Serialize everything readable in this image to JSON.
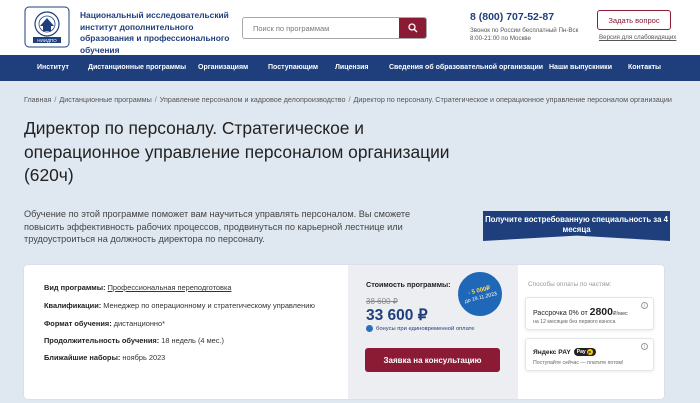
{
  "header": {
    "logo_name": "institute-seal",
    "logo_text": "Национальный исследовательский институт дополнительного образования и профессионального обучения",
    "search_placeholder": "Поиск по программам",
    "phone": "8 (800) 707-52-87",
    "phone_note": "Звонок по России бесплатный Пн-Вск 8:00-21:00 по Москве",
    "ask_button": "Задать вопрос",
    "impaired_link": "Версия для слабовидящих"
  },
  "nav": {
    "items": [
      {
        "label": "Институт"
      },
      {
        "label": "Дистанционные программы"
      },
      {
        "label": "Организациям"
      },
      {
        "label": "Поступающим"
      },
      {
        "label": "Лицензия"
      },
      {
        "label": "Сведения об образовательной организации"
      },
      {
        "label": "Наши выпускники"
      },
      {
        "label": "Контакты"
      }
    ]
  },
  "breadcrumb": {
    "items": [
      {
        "label": "Главная"
      },
      {
        "label": "Дистанционные программы"
      },
      {
        "label": "Управление персоналом и кадровое делопроизводство"
      },
      {
        "label": "Директор по персоналу. Стратегическое и операционное управление персоналом организации"
      }
    ],
    "separator": "/"
  },
  "page": {
    "title": "Директор по персоналу. Стратегическое и операционное управление персоналом организации (620ч)",
    "description": "Обучение по этой программе поможет вам научиться управлять персоналом. Вы сможете повысить эффективность рабочих процессов, продвинуться по карьерной лестнице или трудоустроиться на должность директора по персоналу.",
    "badge": "Получите востребованную специальность за 4 месяца"
  },
  "program": {
    "rows": [
      {
        "label": "Вид программы:",
        "value": "Профессиональная переподготовка",
        "link": true
      },
      {
        "label": "Квалификации:",
        "value": "Менеджер по операционному и стратегическому управлению",
        "link": false
      },
      {
        "label": "Формат обучения:",
        "value": "дистанционно*",
        "link": false
      },
      {
        "label": "Продолжительность обучения:",
        "value": "18 недель (4 мес.)",
        "link": false
      },
      {
        "label": "Ближайшие наборы:",
        "value": "ноябрь 2023",
        "link": false
      }
    ]
  },
  "price": {
    "label": "Стоимость программы:",
    "old": "38 600 ₽",
    "new": "33 600 ₽",
    "bonus": "бонусы при единовременной оплате",
    "discount_amount": "- 5 000₽",
    "discount_until": "до 19.11.2023",
    "consult_button": "Заявка на консультацию"
  },
  "payment": {
    "title": "Способы оплаты по частям:",
    "installment_prefix": "Рассрочка 0% от",
    "installment_amount": "2800",
    "installment_unit": "₽/мес",
    "installment_note": "на 12 месяцев без первого взноса",
    "yandex_title": "Яндекс PAY",
    "yandex_logo": "Pay",
    "yandex_note": "Поступайте сейчас — платите потом!",
    "info_icon": "i"
  },
  "colors": {
    "navy": "#1f3f7c",
    "burgundy": "#8b1a35",
    "background": "#dfe7f0",
    "discount_blue": "#1f67b7"
  }
}
